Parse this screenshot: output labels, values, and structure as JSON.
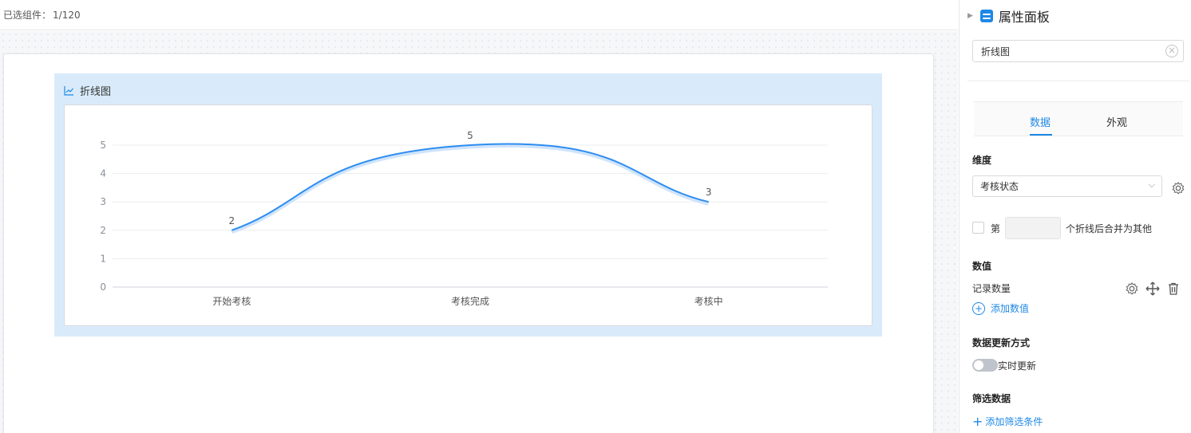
{
  "topbar": {
    "selected_label": "已选组件：",
    "selected_count": "1/120"
  },
  "widget": {
    "title": "折线图",
    "title_icon": "line-chart-icon"
  },
  "chart_data": {
    "type": "line",
    "categories": [
      "开始考核",
      "考核完成",
      "考核中"
    ],
    "values": [
      2,
      5,
      3
    ],
    "data_labels": [
      "2",
      "5",
      "3"
    ],
    "y_ticks": [
      "0",
      "1",
      "2",
      "3",
      "4",
      "5"
    ],
    "ylim": [
      0,
      5
    ],
    "smooth": true,
    "grid": true,
    "line_color": "#2d8cf0"
  },
  "panel": {
    "title": "属性面板",
    "title_icon": "settings-sliders-icon",
    "component_name": "折线图",
    "tabs": [
      {
        "label": "数据",
        "active": true
      },
      {
        "label": "外观",
        "active": false
      }
    ],
    "dimension": {
      "label": "维度",
      "selected": "考核状态"
    },
    "merge": {
      "prefix": "第",
      "suffix": "个折线后合并为其他",
      "value": ""
    },
    "value_section": {
      "label": "数值",
      "record_label": "记录数量",
      "add_label": "添加数值"
    },
    "update_section": {
      "label": "数据更新方式",
      "toggle_label": "实时更新",
      "toggle_on": false
    },
    "filter_section": {
      "label": "筛选数据",
      "add_label": "添加筛选条件"
    },
    "accent_color": "#1e88e5"
  }
}
